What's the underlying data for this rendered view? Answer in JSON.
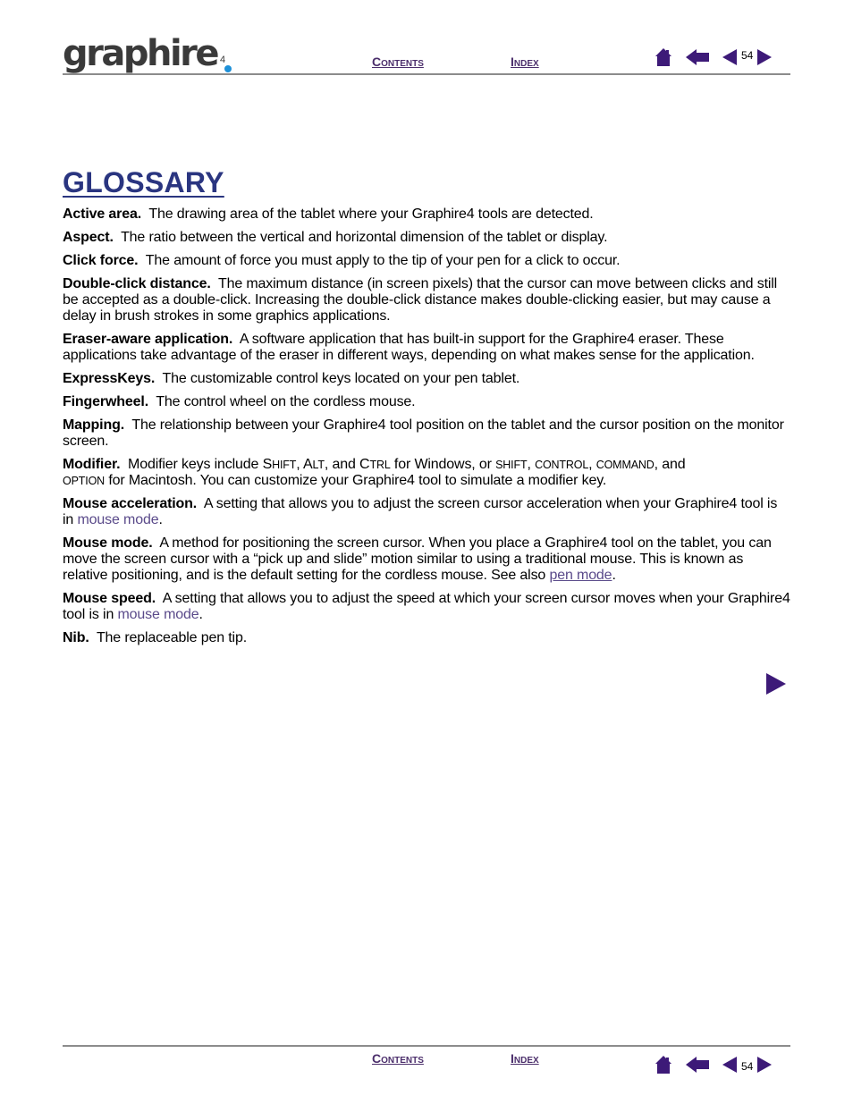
{
  "header": {
    "logo_text": "graphire",
    "logo_suffix": "4",
    "contents_label": "Contents",
    "index_label": "Index",
    "page_number": "54"
  },
  "footer": {
    "contents_label": "Contents",
    "index_label": "Index",
    "page_number": "54"
  },
  "icons": {
    "home": "home-icon",
    "back": "back-arrow-icon",
    "prev": "previous-page-icon",
    "next": "next-page-icon"
  },
  "colors": {
    "nav_purple": "#3d1a78",
    "title_blue": "#2a3580",
    "link_purple": "#5a4a8a",
    "rule_gray": "#8c8c8c"
  },
  "page_title": "GLOSSARY",
  "entries": [
    {
      "term": "Active area.",
      "text": "The drawing area of the tablet where your Graphire4 tools are detected."
    },
    {
      "term": "Aspect.",
      "text": "The ratio between the vertical and horizontal dimension of the tablet or display."
    },
    {
      "term": "Click force.",
      "text": "The amount of force you must apply to the tip of your pen for a click to occur."
    },
    {
      "term": "Double-click distance.",
      "text": "The maximum distance (in screen pixels) that the cursor can move between clicks and still be accepted as a double-click.  Increasing the double-click distance makes double-clicking easier, but may cause a delay in brush strokes in some graphics applications."
    },
    {
      "term": "Eraser-aware application.",
      "text": "A software application that has built-in support for the Graphire4 eraser. These applications take advantage of the eraser in different ways, depending on what makes sense for the application."
    },
    {
      "term": "ExpressKeys.",
      "text": "The customizable control keys located on your pen tablet."
    },
    {
      "term": "Fingerwheel.",
      "text": "The control wheel on the cordless mouse."
    },
    {
      "term": "Mapping.",
      "text": "The relationship between your Graphire4 tool position on the tablet and the cursor position on the monitor screen."
    },
    {
      "term": "Modifier.",
      "text_a": "Modifier keys include ",
      "k1": "Shift",
      "s1": ", ",
      "k2": "Alt",
      "s2": ", and ",
      "k3": "Ctrl",
      "s3": " for Windows, or ",
      "k4": "shift",
      "s4": ", ",
      "k5": "control",
      "s5": ", ",
      "k6": "command",
      "s6": ", and ",
      "k7": "option",
      "text_b": " for Macintosh.  You can customize your Graphire4 tool to simulate a modifier key."
    },
    {
      "term": "Mouse acceleration.",
      "text": "A setting that allows you to adjust the screen cursor acceleration when your Graphire4 tool is in ",
      "link": "mouse mode",
      "after": "."
    },
    {
      "term": "Mouse mode.",
      "text": "A method for positioning the screen cursor.   When you place a Graphire4 tool on the tablet, you can move the screen cursor with a “pick up and slide” motion similar to using a traditional mouse. This is known as relative positioning, and is the default setting for the cordless mouse.  See also ",
      "link": "pen mode",
      "after": "."
    },
    {
      "term": "Mouse speed.",
      "text": "A setting that allows you to adjust the speed at which your screen cursor moves when your Graphire4 tool is in ",
      "link": "mouse mode",
      "after": "."
    },
    {
      "term": "Nib.",
      "text": "The replaceable pen tip."
    }
  ]
}
